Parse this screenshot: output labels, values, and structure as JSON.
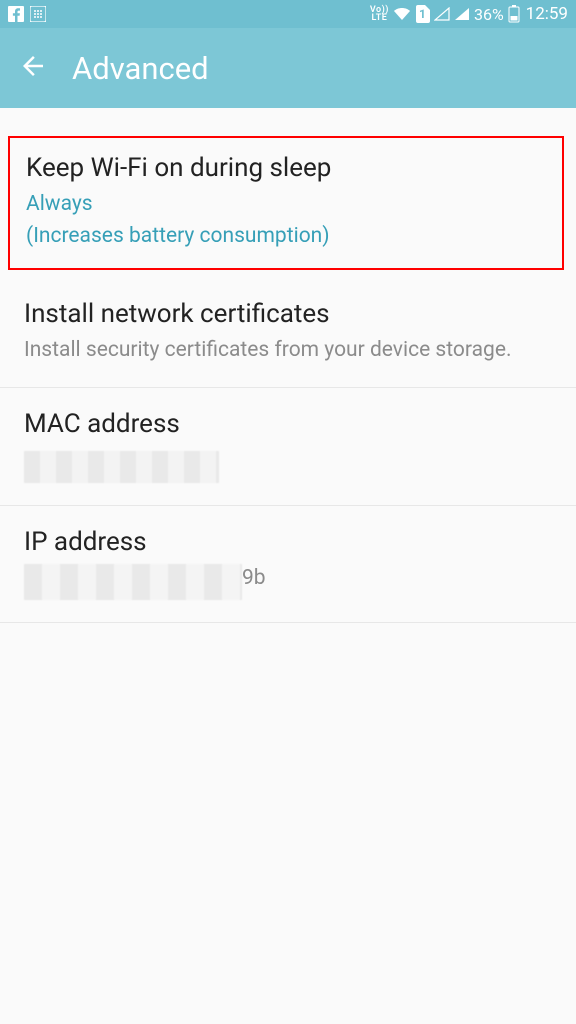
{
  "status": {
    "volte": "Vo))\nLTE",
    "sim_label": "1",
    "battery_pct": "36%",
    "clock": "12:59"
  },
  "header": {
    "title": "Advanced"
  },
  "items": {
    "wifi_sleep": {
      "title": "Keep Wi-Fi on during sleep",
      "value": "Always",
      "note": "(Increases battery consumption)"
    },
    "certs": {
      "title": "Install network certificates",
      "desc": "Install security certificates from your device storage."
    },
    "mac": {
      "title": "MAC address"
    },
    "ip": {
      "title": "IP address",
      "visible_fragment": "9b"
    }
  }
}
